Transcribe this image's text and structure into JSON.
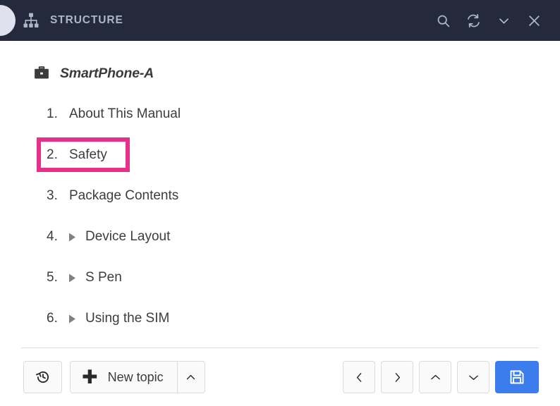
{
  "header": {
    "title": "STRUCTURE",
    "logo_icon": "structure-hierarchy-icon",
    "avatar_icon": "user-avatar-circle",
    "actions": [
      {
        "name": "search-icon",
        "label": "Search"
      },
      {
        "name": "refresh-icon",
        "label": "Refresh"
      },
      {
        "name": "chevron-down-icon",
        "label": "More"
      },
      {
        "name": "close-icon",
        "label": "Close"
      }
    ],
    "colors": {
      "background": "#242a3c",
      "text": "#aeb5c9"
    }
  },
  "root": {
    "icon": "briefcase-icon",
    "label": "SmartPhone-A"
  },
  "topics": [
    {
      "number": "1.",
      "label": "About This Manual",
      "expandable": false,
      "highlighted": false
    },
    {
      "number": "2.",
      "label": "Safety",
      "expandable": false,
      "highlighted": true
    },
    {
      "number": "3.",
      "label": "Package Contents",
      "expandable": false,
      "highlighted": false
    },
    {
      "number": "4.",
      "label": "Device Layout",
      "expandable": true,
      "highlighted": false
    },
    {
      "number": "5.",
      "label": "S Pen",
      "expandable": true,
      "highlighted": false
    },
    {
      "number": "6.",
      "label": "Using the SIM",
      "expandable": true,
      "highlighted": false
    }
  ],
  "highlight": {
    "color": "#e8308a"
  },
  "footer": {
    "history_button": {
      "name": "history-icon",
      "label": "History"
    },
    "new_topic": {
      "label": "New topic",
      "plus_icon": "plus-icon",
      "caret_icon": "chevron-up-icon"
    },
    "nav": [
      {
        "name": "nav-left-button",
        "icon": "chevron-left-icon"
      },
      {
        "name": "nav-right-button",
        "icon": "chevron-right-icon"
      },
      {
        "name": "nav-up-button",
        "icon": "chevron-up-icon"
      },
      {
        "name": "nav-down-button",
        "icon": "chevron-down-icon"
      }
    ],
    "save": {
      "name": "save-button",
      "icon": "floppy-disk-icon",
      "color": "#3b7ded"
    }
  }
}
